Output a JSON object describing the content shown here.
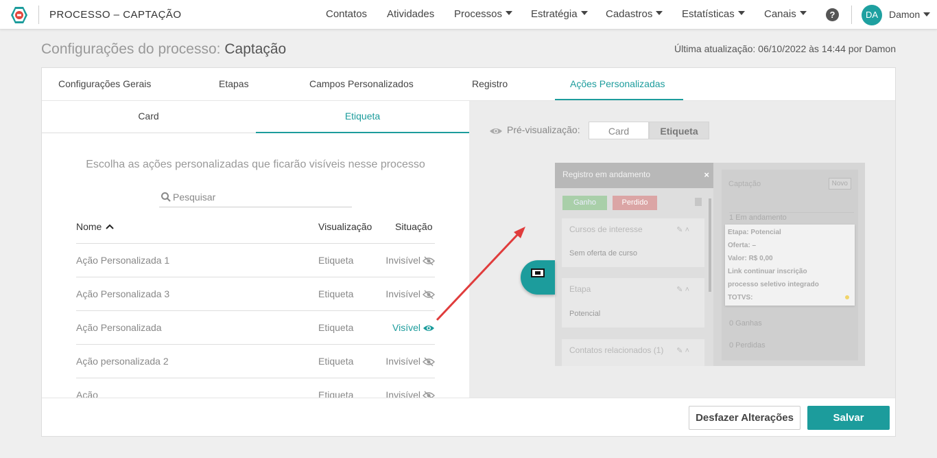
{
  "app": {
    "title": "PROCESSO – CAPTAÇÃO",
    "logo_icon": "logo-icon"
  },
  "nav": {
    "items": [
      "Contatos",
      "Atividades",
      "Processos",
      "Estratégia",
      "Cadastros",
      "Estatísticas",
      "Canais"
    ],
    "help_label": "?",
    "avatar_initials": "DA",
    "user_name": "Damon"
  },
  "page": {
    "title_prefix": "Configurações do processo:",
    "title_name": "Captação",
    "last_update": "Última atualização: 06/10/2022 às 14:44 por Damon"
  },
  "tabs": [
    "Configurações Gerais",
    "Etapas",
    "Campos Personalizados",
    "Registro",
    "Ações Personalizadas"
  ],
  "active_tab": "Ações Personalizadas",
  "subtabs": [
    "Card",
    "Etiqueta"
  ],
  "active_subtab": "Etiqueta",
  "left": {
    "instruction": "Escolha as ações personalizadas que ficarão visíveis nesse processo",
    "search_placeholder": "Pesquisar",
    "columns": {
      "name": "Nome",
      "visualization": "Visualização",
      "status": "Situação"
    },
    "rows": [
      {
        "name": "Ação Personalizada 1",
        "view": "Etiqueta",
        "status": "Invisível",
        "visible": false
      },
      {
        "name": "Ação Personalizada 3",
        "view": "Etiqueta",
        "status": "Invisível",
        "visible": false
      },
      {
        "name": "Ação Personalizada",
        "view": "Etiqueta",
        "status": "Visível",
        "visible": true
      },
      {
        "name": "Ação personalizada 2",
        "view": "Etiqueta",
        "status": "Invisível",
        "visible": false
      },
      {
        "name": "Ação",
        "view": "Etiqueta",
        "status": "Invisível",
        "visible": false
      }
    ]
  },
  "preview": {
    "label": "Pré-visualização:",
    "options": [
      "Card",
      "Etiqueta"
    ],
    "selected": "Etiqueta",
    "mock": {
      "header": "Registro em andamento",
      "close": "×",
      "won": "Ganho",
      "lost": "Perdido",
      "boxes": [
        {
          "title": "Cursos de interesse",
          "value": "Sem oferta de curso"
        },
        {
          "title": "Etapa",
          "value": "Potencial"
        },
        {
          "title": "Contatos relacionados (1)",
          "value": ""
        }
      ],
      "column_title": "Captação",
      "new_button": "Novo",
      "section_in_progress": "1 Em andamento",
      "tag_lines": [
        "Etapa: Potencial",
        "Oferta: –",
        "Valor: R$ 0,00",
        "Link continuar inscrição",
        "processo seletivo integrado",
        "TOTVS:"
      ],
      "won_count": "0 Ganhas",
      "lost_count": "0 Perdidas"
    }
  },
  "footer": {
    "undo_label": "Desfazer Alterações",
    "save_label": "Salvar"
  },
  "colors": {
    "accent": "#1c9c9c",
    "arrow": "#e03c3c"
  }
}
